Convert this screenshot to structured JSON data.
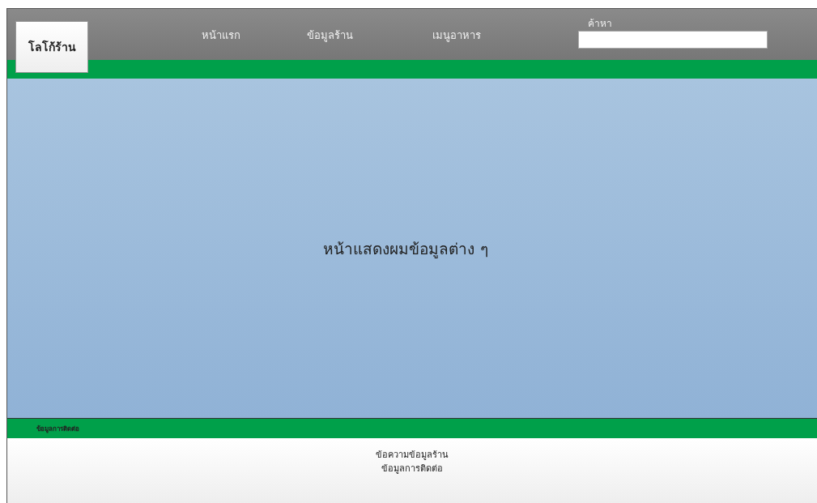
{
  "logo": "โลโก้ร้าน",
  "nav": [
    {
      "label": "หน้าแรก"
    },
    {
      "label": "ข้อมูลร้าน"
    },
    {
      "label": "เมนูอาหาร"
    }
  ],
  "search": {
    "label": "ค้าหา"
  },
  "content": {
    "text": "หน้าแสดงผมข้อมูลต่าง ๆ"
  },
  "footer_bar": {
    "label": "ข้อมูลการติดต่อ"
  },
  "footer": {
    "lines": [
      "ข้อความข้อมูลร้าน",
      "ข้อมูลการติดต่อ"
    ]
  }
}
